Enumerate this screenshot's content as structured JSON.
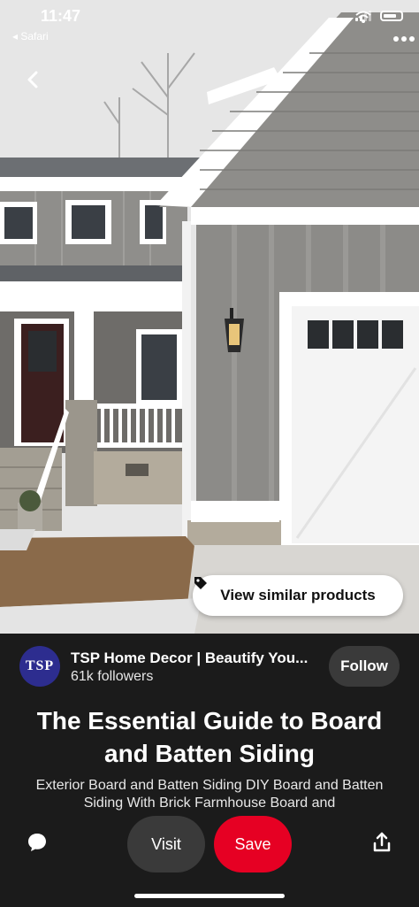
{
  "status_bar": {
    "time": "11:47",
    "back_app": "◂ Safari"
  },
  "nav": {
    "back_icon": "chevron-left-icon",
    "more_icon": "more-horizontal-icon"
  },
  "image": {
    "view_similar_label": "View similar products",
    "tag_icon": "tag-icon"
  },
  "profile": {
    "avatar_text": "TSP",
    "name": "TSP Home Decor | Beautify You...",
    "followers": "61k followers",
    "follow_label": "Follow"
  },
  "pin": {
    "title": "The Essential Guide to Board and Batten Siding",
    "description": "Exterior Board and Batten Siding DIY Board and Batten Siding With Brick Farmhouse Board and"
  },
  "actions": {
    "comment_icon": "comment-icon",
    "visit_label": "Visit",
    "save_label": "Save",
    "share_icon": "share-icon"
  },
  "colors": {
    "background": "#1b1b1b",
    "save": "#e60023",
    "secondary_button": "#3a3a3a"
  }
}
